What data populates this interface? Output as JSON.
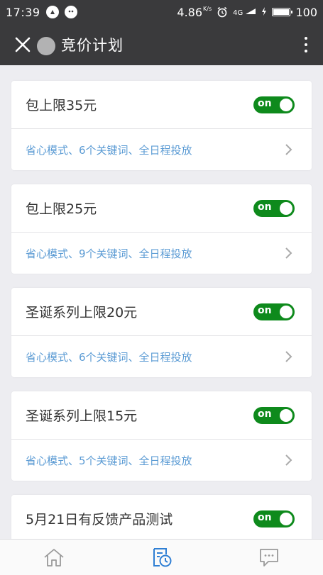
{
  "status_bar": {
    "time": "17:39",
    "net_speed": "4.86",
    "net_unit": "K/s",
    "signal_label": "4G",
    "battery_level": "100"
  },
  "nav": {
    "title": "竞价计划"
  },
  "plans": [
    {
      "title": "包上限35元",
      "toggle": "on",
      "desc": "省心模式、6个关键词、全日程投放"
    },
    {
      "title": "包上限25元",
      "toggle": "on",
      "desc": "省心模式、9个关键词、全日程投放"
    },
    {
      "title": "圣诞系列上限20元",
      "toggle": "on",
      "desc": "省心模式、6个关键词、全日程投放"
    },
    {
      "title": "圣诞系列上限15元",
      "toggle": "on",
      "desc": "省心模式、5个关键词、全日程投放"
    },
    {
      "title": "5月21日有反馈产品测试",
      "toggle": "on",
      "desc": ""
    }
  ],
  "colors": {
    "bar": "#3a3a3c",
    "toggle_on": "#0e8a1c",
    "desc": "#5b9bd4",
    "tab_active": "#2f7fd4",
    "tab_inactive": "#9a9a9a"
  },
  "tabs": [
    {
      "icon": "home-icon",
      "active": false
    },
    {
      "icon": "plan-clock-icon",
      "active": true
    },
    {
      "icon": "message-icon",
      "active": false
    }
  ]
}
